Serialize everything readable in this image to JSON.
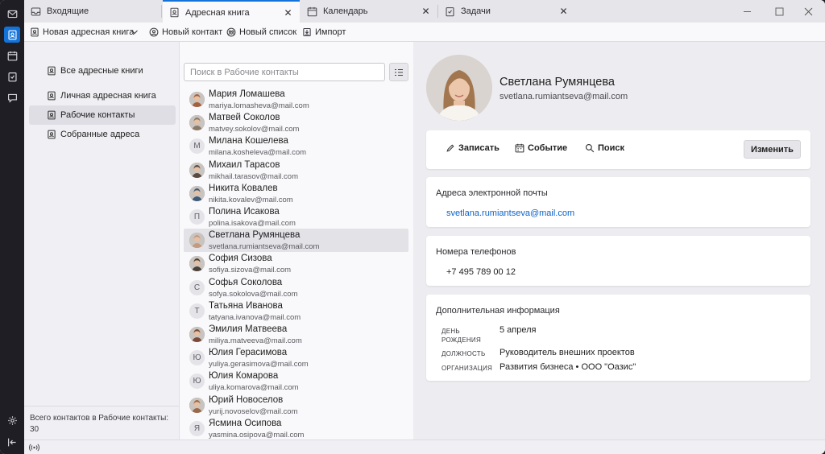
{
  "tabs": [
    {
      "label": "Входящие",
      "icon": "inbox-icon"
    },
    {
      "label": "Адресная книга",
      "icon": "address-book-icon"
    },
    {
      "label": "Календарь",
      "icon": "calendar-icon"
    },
    {
      "label": "Задачи",
      "icon": "tasks-icon"
    }
  ],
  "toolbar": {
    "new_address_book": "Новая адресная книга",
    "new_contact": "Новый контакт",
    "new_list": "Новый список",
    "import": "Импорт"
  },
  "sidebar": {
    "books": [
      {
        "label": "Все адресные книги"
      },
      {
        "label": "Личная адресная книга"
      },
      {
        "label": "Рабочие контакты"
      },
      {
        "label": "Собранные адреса"
      }
    ],
    "footer": "Всего контактов в Рабочие контакты: 30"
  },
  "list": {
    "search_placeholder": "Поиск в Рабочие контакты",
    "contacts": [
      {
        "name": "Мария Ломашева",
        "email": "mariya.lomasheva@mail.com",
        "initial": "",
        "photo": true,
        "tone": "#a5603f"
      },
      {
        "name": "Матвей Соколов",
        "email": "matvey.sokolov@mail.com",
        "initial": "",
        "photo": true,
        "tone": "#8b7a68"
      },
      {
        "name": "Милана Кошелева",
        "email": "milana.kosheleva@mail.com",
        "initial": "М",
        "photo": false
      },
      {
        "name": "Михаил Тарасов",
        "email": "mikhail.tarasov@mail.com",
        "initial": "",
        "photo": true,
        "tone": "#5a4a40"
      },
      {
        "name": "Никита Ковалев",
        "email": "nikita.kovalev@mail.com",
        "initial": "",
        "photo": true,
        "tone": "#3e5a78"
      },
      {
        "name": "Полина Исакова",
        "email": "polina.isakova@mail.com",
        "initial": "П",
        "photo": false
      },
      {
        "name": "Светлана Румянцева",
        "email": "svetlana.rumiantseva@mail.com",
        "initial": "",
        "photo": true,
        "tone": "#c49a80"
      },
      {
        "name": "София Сизова",
        "email": "sofiya.sizova@mail.com",
        "initial": "",
        "photo": true,
        "tone": "#4a4038"
      },
      {
        "name": "Софья Соколова",
        "email": "sofya.sokolova@mail.com",
        "initial": "С",
        "photo": false
      },
      {
        "name": "Татьяна Иванова",
        "email": "tatyana.ivanova@mail.com",
        "initial": "Т",
        "photo": false
      },
      {
        "name": "Эмилия Матвеева",
        "email": "miliya.matveeva@mail.com",
        "initial": "",
        "photo": true,
        "tone": "#7a4a3a"
      },
      {
        "name": "Юлия Герасимова",
        "email": "yuliya.gerasimova@mail.com",
        "initial": "Ю",
        "photo": false
      },
      {
        "name": "Юлия Комарова",
        "email": "uliya.komarova@mail.com",
        "initial": "Ю",
        "photo": false
      },
      {
        "name": "Юрий Новоселов",
        "email": "yurij.novoselov@mail.com",
        "initial": "",
        "photo": true,
        "tone": "#9a6a48"
      },
      {
        "name": "Ясмина Осипова",
        "email": "yasmina.osipova@mail.com",
        "initial": "Я",
        "photo": false
      }
    ],
    "selected_index": 6
  },
  "details": {
    "name": "Светлана Румянцева",
    "email": "svetlana.rumiantseva@mail.com",
    "actions": {
      "write": "Записать",
      "event": "Событие",
      "search": "Поиск",
      "edit": "Изменить"
    },
    "emails_title": "Адреса электронной почты",
    "email_value": "svetlana.rumiantseva@mail.com",
    "phones_title": "Номера телефонов",
    "phone_value": "+7 495 789 00 12",
    "extra_title": "Дополнительная информация",
    "birthday_label_1": "ДЕНЬ",
    "birthday_label_2": "РОЖДЕНИЯ",
    "birthday_value": "5 апреля",
    "position_label": "ДОЛЖНОСТЬ",
    "position_value": "Руководитель внешних проектов",
    "org_label": "ОРГАНИЗАЦИЯ",
    "org_value": "Развития бизнеса • ООО \"Оазис\""
  },
  "colors": {
    "accent": "#1373d9",
    "link": "#0a63c9"
  }
}
